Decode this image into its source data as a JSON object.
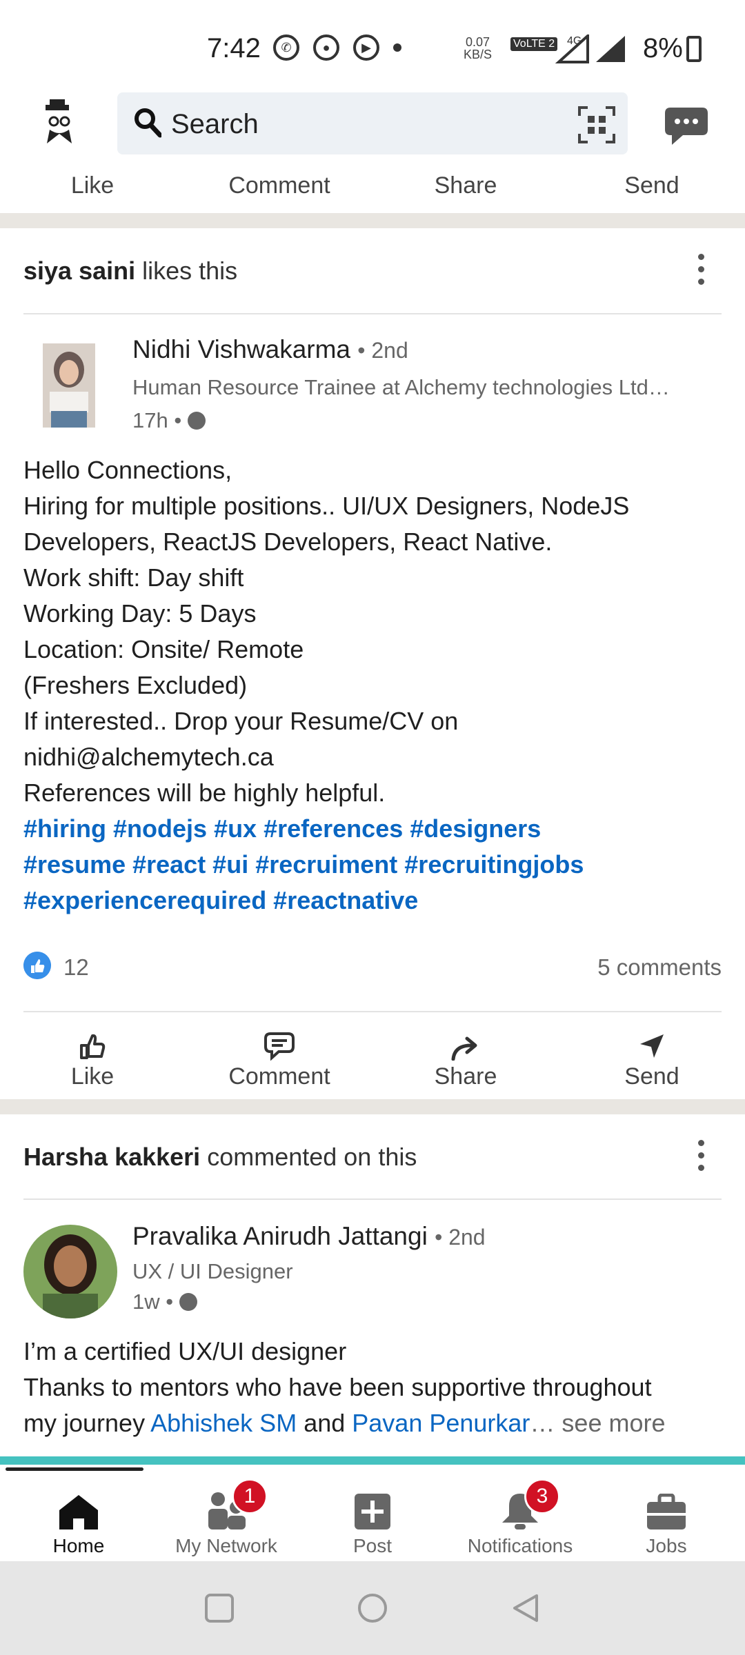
{
  "status_bar": {
    "time": "7:42",
    "speed_value": "0.07",
    "speed_unit": "KB/S",
    "lte_label": "VoLTE 2",
    "network": "4G",
    "battery": "8%"
  },
  "header": {
    "search_placeholder": "Search"
  },
  "prev_post_actions": [
    "Like",
    "Comment",
    "Share",
    "Send"
  ],
  "post1": {
    "context_name": "siya saini",
    "context_text": " likes this",
    "author": "Nidhi Vishwakarma",
    "degree": "• 2nd",
    "headline": "Human Resource Trainee at Alchemy technologies Ltd…",
    "time": "17h •",
    "lines": [
      "Hello Connections,",
      "Hiring for multiple positions.. UI/UX Designers, NodeJS",
      "Developers, ReactJS Developers, React Native.",
      "Work shift: Day shift",
      "Working Day: 5 Days",
      "Location: Onsite/ Remote",
      "(Freshers Excluded)",
      "If interested.. Drop your Resume/CV on",
      "nidhi@alchemytech.ca",
      "References will be highly helpful."
    ],
    "hashtags": [
      "#hiring #nodejs #ux #references #designers",
      "#resume #react #ui #recruiment #recruitingjobs",
      "#experiencerequired #reactnative"
    ],
    "likes": "12",
    "comments": "5 comments",
    "actions": [
      "Like",
      "Comment",
      "Share",
      "Send"
    ]
  },
  "post2": {
    "context_name": "Harsha kakkeri",
    "context_text": " commented on this",
    "author": "Pravalika Anirudh Jattangi",
    "degree": "• 2nd",
    "headline": "UX / UI Designer",
    "time": "1w •",
    "line1": "I’m a certified UX/UI designer",
    "line2": "Thanks to mentors who have been supportive throughout",
    "line3_prefix": "my journey ",
    "mention1": "Abhishek SM",
    "and": " and ",
    "mention2": "Pavan Penurkar",
    "ellipsis": "…",
    "see_more": " see more"
  },
  "bottom_nav": {
    "home": "Home",
    "network": "My Network",
    "network_badge": "1",
    "post": "Post",
    "notifications": "Notifications",
    "notifications_badge": "3",
    "jobs": "Jobs"
  },
  "colors": {
    "link": "#0a66c2",
    "badge": "#d11124",
    "separator": "#e9e6e1",
    "search_bg": "#edf1f5"
  }
}
